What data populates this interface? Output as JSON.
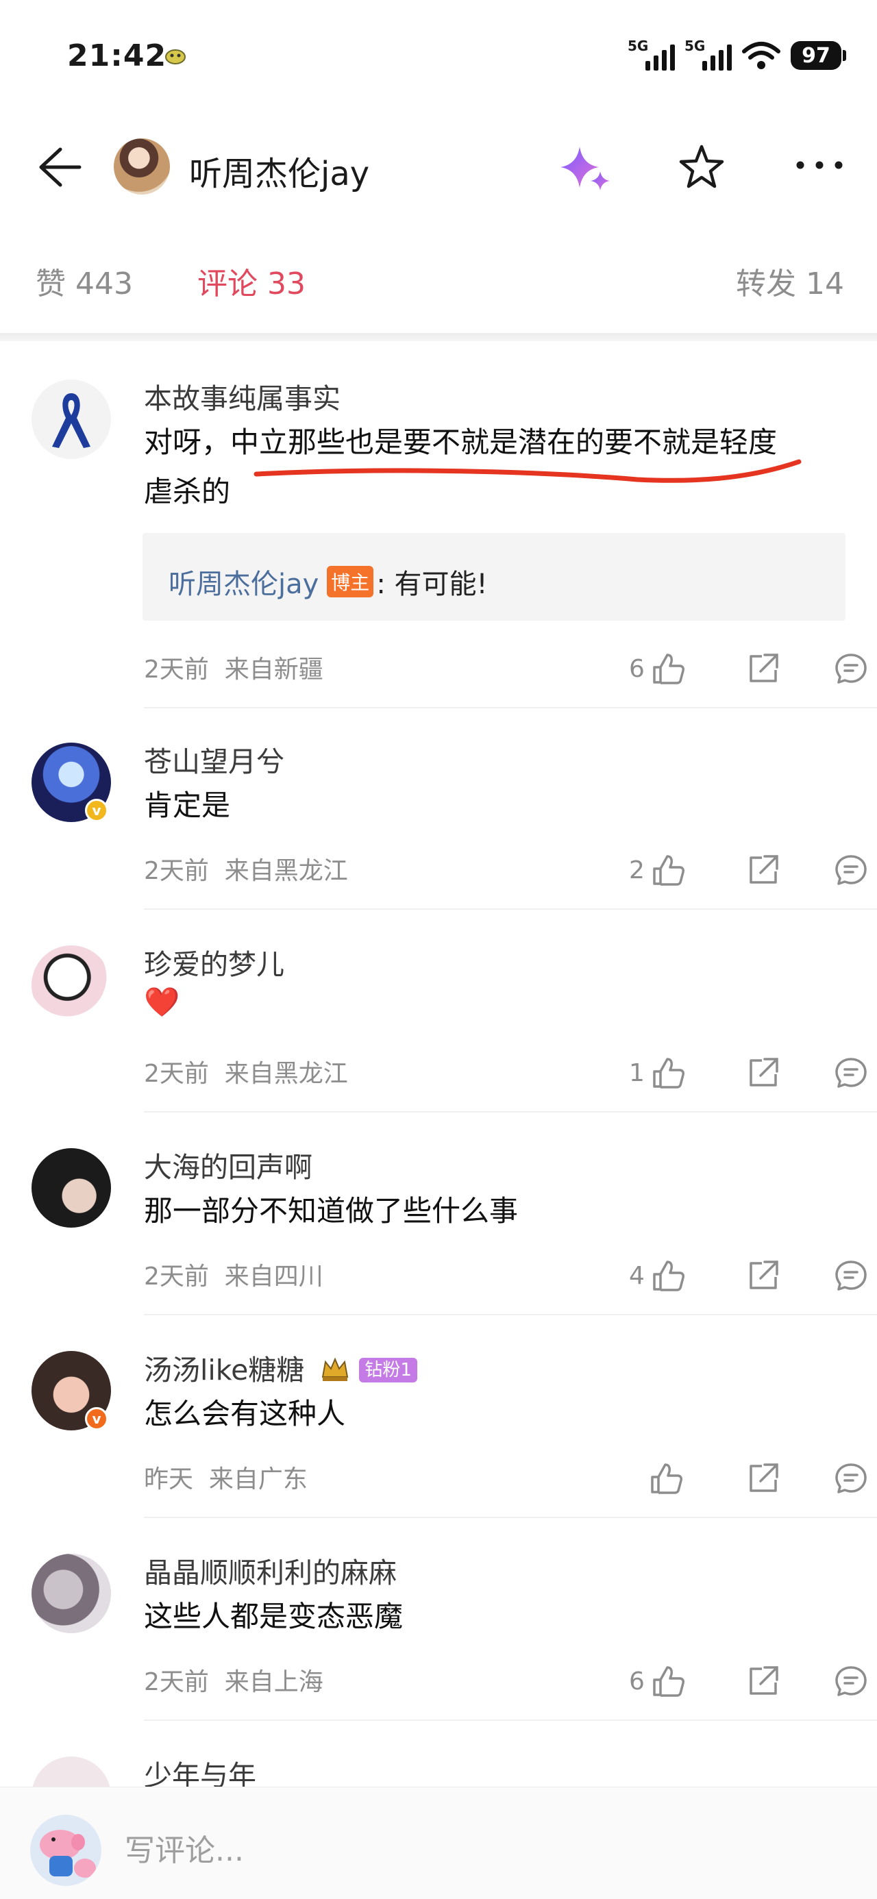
{
  "status_bar": {
    "time": "21:42",
    "net1": "5G",
    "net2": "5G",
    "battery": "97"
  },
  "nav": {
    "title": "听周杰伦jay"
  },
  "tabs": {
    "likes": "赞 443",
    "comments": "评论 33",
    "reposts": "转发 14"
  },
  "comments": [
    {
      "author": "本故事纯属事实",
      "text_line1": "对呀，中立那些也是要不就是潜在的要不就是轻度",
      "text_line2": "虐杀的",
      "time": "2天前",
      "location": "来自新疆",
      "likes": "6",
      "reply": {
        "name": "听周杰伦jay",
        "badge": "博主",
        "text": ": 有可能!"
      }
    },
    {
      "author": "苍山望月兮",
      "text": "肯定是",
      "time": "2天前",
      "location": "来自黑龙江",
      "likes": "2"
    },
    {
      "author": "珍爱的梦儿",
      "text": "❤️",
      "time": "2天前",
      "location": "来自黑龙江",
      "likes": "1"
    },
    {
      "author": "大海的回声啊",
      "text": "那一部分不知道做了些什么事",
      "time": "2天前",
      "location": "来自四川",
      "likes": "4"
    },
    {
      "author": "汤汤like糖糖",
      "fan_badge": "钻粉1",
      "text": "怎么会有这种人",
      "time": "昨天",
      "location": "来自广东",
      "likes": ""
    },
    {
      "author": "晶晶顺顺利利的麻麻",
      "text": "这些人都是变态恶魔",
      "time": "2天前",
      "location": "来自上海",
      "likes": "6"
    },
    {
      "author": "少年与年"
    }
  ],
  "input": {
    "placeholder": "写评论..."
  },
  "colors": {
    "accent": "#e0495e",
    "link": "#4c6e9c",
    "badge": "#f5722a",
    "underline": "#e5341f"
  }
}
